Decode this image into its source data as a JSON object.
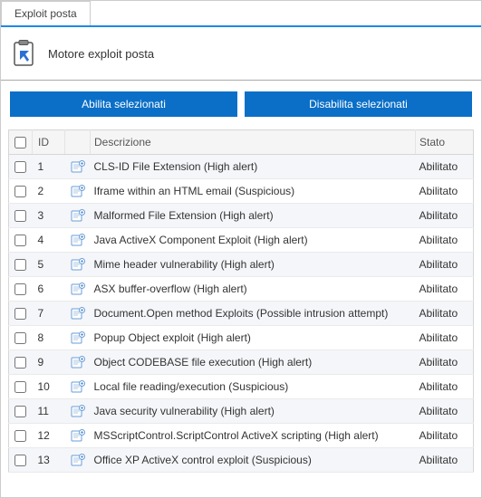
{
  "tab": {
    "label": "Exploit posta"
  },
  "header": {
    "title": "Motore exploit posta"
  },
  "buttons": {
    "enable": "Abilita selezionati",
    "disable": "Disabilita selezionati"
  },
  "columns": {
    "id": "ID",
    "description": "Descrizione",
    "status": "Stato"
  },
  "rows": [
    {
      "id": "1",
      "description": "CLS-ID File Extension (High alert)",
      "status": "Abilitato"
    },
    {
      "id": "2",
      "description": "Iframe within an HTML email (Suspicious)",
      "status": "Abilitato"
    },
    {
      "id": "3",
      "description": "Malformed File Extension (High alert)",
      "status": "Abilitato"
    },
    {
      "id": "4",
      "description": "Java ActiveX Component Exploit (High alert)",
      "status": "Abilitato"
    },
    {
      "id": "5",
      "description": "Mime header vulnerability (High alert)",
      "status": "Abilitato"
    },
    {
      "id": "6",
      "description": "ASX buffer-overflow (High alert)",
      "status": "Abilitato"
    },
    {
      "id": "7",
      "description": "Document.Open method Exploits (Possible intrusion attempt)",
      "status": "Abilitato"
    },
    {
      "id": "8",
      "description": "Popup Object exploit (High alert)",
      "status": "Abilitato"
    },
    {
      "id": "9",
      "description": "Object CODEBASE file execution (High alert)",
      "status": "Abilitato"
    },
    {
      "id": "10",
      "description": "Local file reading/execution (Suspicious)",
      "status": "Abilitato"
    },
    {
      "id": "11",
      "description": "Java security vulnerability (High alert)",
      "status": "Abilitato"
    },
    {
      "id": "12",
      "description": "MSScriptControl.ScriptControl ActiveX scripting (High alert)",
      "status": "Abilitato"
    },
    {
      "id": "13",
      "description": "Office XP ActiveX control exploit (Suspicious)",
      "status": "Abilitato"
    }
  ]
}
